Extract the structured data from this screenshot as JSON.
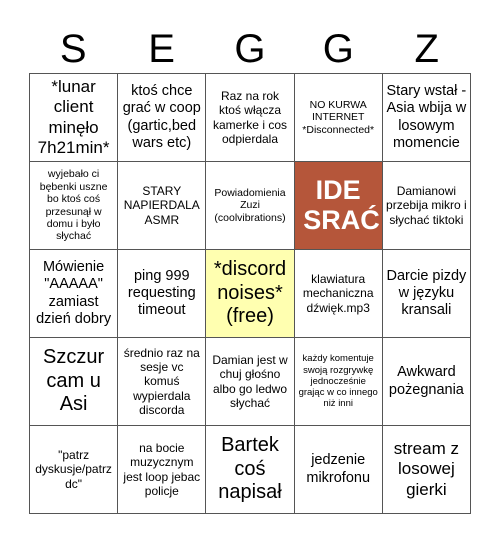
{
  "header": {
    "letters": [
      "S",
      "E",
      "G",
      "G",
      "Z"
    ]
  },
  "cells": [
    [
      "*lunar client minęło 7h21min*",
      "ktoś chce grać w coop (gartic,bed wars etc)",
      "Raz na rok ktoś włącza kamerke i cos odpierdala",
      "NO KURWA INTERNET *Disconnected*",
      "Stary wstał - Asia wbija w losowym momencie"
    ],
    [
      "wyjebało ci bębenki uszne bo ktoś coś przesunął w domu i było słychać",
      "STARY NAPIERDALA ASMR",
      "Powiadomienia Zuzi (coolvibrations)",
      "IDE SRAĆ",
      "Damianowi przebija mikro i słychać tiktoki"
    ],
    [
      "Mówienie \"AAAAA\" zamiast dzień dobry",
      "ping 999 requesting timeout",
      "*discord noises* (free)",
      "klawiatura mechaniczna dźwięk.mp3",
      "Darcie pizdy w języku kransali"
    ],
    [
      "Szczur cam u Asi",
      "średnio raz na sesje vc komuś wypierdala discorda",
      "Damian jest w chuj głośno albo go ledwo słychać",
      "każdy komentuje swoją rozgrywkę jednocześnie grając w co innego niż inni",
      "Awkward pożegnania"
    ],
    [
      "\"patrz dyskusje/patrz dc\"",
      "na bocie muzycznym jest loop jebac policje",
      "Bartek coś napisał",
      "jedzenie mikrofonu",
      "stream z losowej gierki"
    ]
  ],
  "colors": {
    "free_cell": "#ffffb0",
    "highlight_cell": "#b5563a",
    "grid_line": "#555555"
  }
}
